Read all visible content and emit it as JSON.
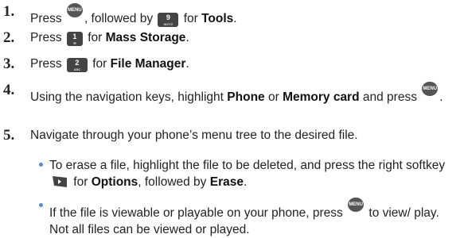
{
  "steps": [
    {
      "num": "1.",
      "a": "Press ",
      "b": ", followed by ",
      "c": " for ",
      "bold": "Tools",
      "d": "."
    },
    {
      "num": "2.",
      "a": "Press ",
      "b": " for ",
      "bold": "Mass Storage",
      "c": "."
    },
    {
      "num": "3.",
      "a": "Press ",
      "b": " for ",
      "bold": "File Manager",
      "c": "."
    },
    {
      "num": "4.",
      "a": "Using the navigation keys, highlight ",
      "bold1": "Phone",
      "b": " or ",
      "bold2": "Memory card",
      "c": " and press ",
      "d": "."
    },
    {
      "num": "5.",
      "text": "Navigate through your phone’s menu tree to the desired file."
    }
  ],
  "bullets": [
    {
      "a": "To erase a file, highlight the file to be deleted, and press the right softkey ",
      "b": " for ",
      "bold1": "Options",
      "c": ", followed by ",
      "bold2": "Erase",
      "d": "."
    },
    {
      "a": "If the file is viewable or playable on your phone, press ",
      "b": " to view/ play. Not all files can be viewed or played."
    }
  ],
  "keys": {
    "menu_ok": "MENU OK",
    "key9": "9",
    "key9_sub": "WXYZ",
    "key1": "1",
    "key2": "2",
    "key2_sub": "ABC"
  },
  "colors": {
    "bullet": "#4a90d9",
    "key": "#444444",
    "text": "#222222"
  }
}
